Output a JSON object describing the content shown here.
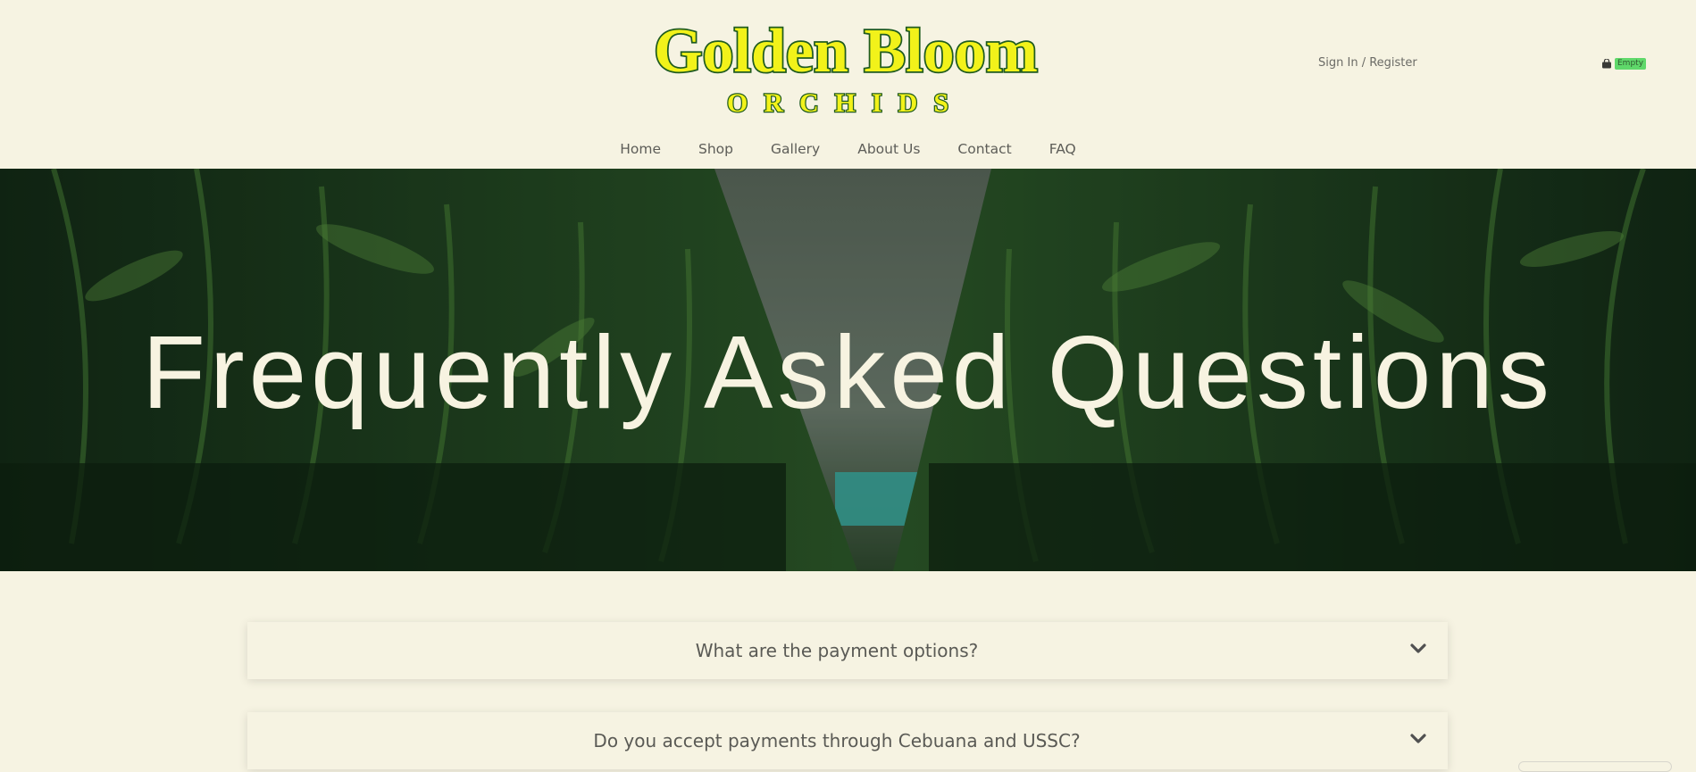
{
  "brand": {
    "logo_line1": "Golden Bloom",
    "logo_line2": "ORCHIDS",
    "logo_fill": "#f2f21a",
    "logo_outline": "#1f5b1f"
  },
  "account": {
    "signin_label": "Sign In / Register"
  },
  "cart": {
    "icon": "shopping-bag-icon",
    "status": "Empty",
    "badge_color": "#5fd86a"
  },
  "nav": {
    "items": [
      {
        "label": "Home"
      },
      {
        "label": "Shop"
      },
      {
        "label": "Gallery"
      },
      {
        "label": "About Us"
      },
      {
        "label": "Contact"
      },
      {
        "label": "FAQ"
      }
    ]
  },
  "hero": {
    "title": "Frequently Asked Questions"
  },
  "faq": {
    "items": [
      {
        "question": "What are the payment options?",
        "icon": "chevron-down-icon"
      },
      {
        "question": "Do you accept payments through Cebuana and USSC?",
        "icon": "chevron-down-icon"
      }
    ]
  },
  "colors": {
    "background": "#f6f3e2",
    "hero_text": "#f7f3e1",
    "text": "#5a5a55"
  }
}
